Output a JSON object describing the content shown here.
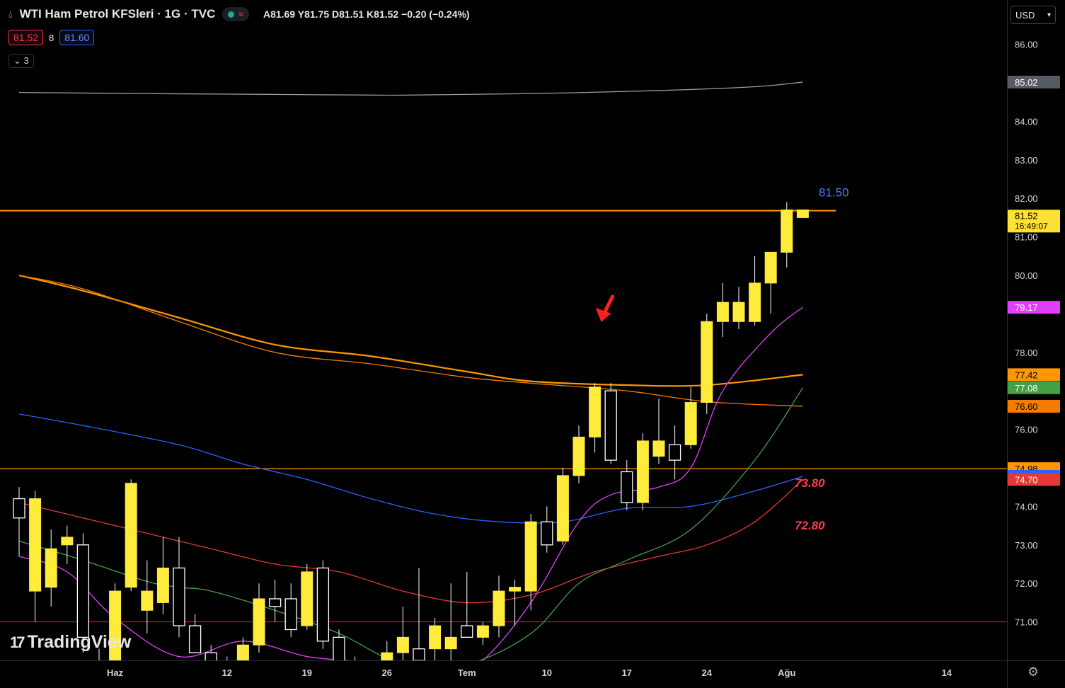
{
  "header": {
    "title": "WTI Ham Petrol KFSleri · 1G · TVC",
    "ohlc": "A81.69  Y81.75  D81.51  K81.52  −0.20 (−0.24%)",
    "sell_price": "81.52",
    "spread": "8",
    "buy_price": "81.60",
    "indicator_count": "3",
    "currency": "USD"
  },
  "logo": {
    "text": "TradingView"
  },
  "chart_data": {
    "type": "candlestick",
    "ylim": [
      70.0,
      86.6
    ],
    "y_ticks": [
      71,
      72,
      73,
      74,
      76,
      78,
      80,
      81,
      82,
      83,
      84,
      86
    ],
    "x_labels": [
      {
        "label": "Haz",
        "i": 6
      },
      {
        "label": "12",
        "i": 13
      },
      {
        "label": "19",
        "i": 18
      },
      {
        "label": "26",
        "i": 23
      },
      {
        "label": "Tem",
        "i": 28
      },
      {
        "label": "10",
        "i": 33
      },
      {
        "label": "17",
        "i": 38
      },
      {
        "label": "24",
        "i": 43
      },
      {
        "label": "Ağu",
        "i": 48
      },
      {
        "label": "14",
        "i": 58
      }
    ],
    "candles": [
      {
        "o": 74.2,
        "h": 74.5,
        "l": 72.7,
        "c": 73.7
      },
      {
        "o": 71.8,
        "h": 74.4,
        "l": 71.0,
        "c": 74.2
      },
      {
        "o": 71.9,
        "h": 73.4,
        "l": 71.4,
        "c": 72.9
      },
      {
        "o": 73.0,
        "h": 73.5,
        "l": 72.5,
        "c": 73.2
      },
      {
        "o": 73.0,
        "h": 73.3,
        "l": 70.2,
        "c": 70.6
      },
      {
        "o": 69.5,
        "h": 70.3,
        "l": 68.8,
        "c": 69.9
      },
      {
        "o": 70.0,
        "h": 72.0,
        "l": 69.8,
        "c": 71.8
      },
      {
        "o": 71.9,
        "h": 74.7,
        "l": 71.8,
        "c": 74.6
      },
      {
        "o": 71.3,
        "h": 72.6,
        "l": 70.7,
        "c": 71.8
      },
      {
        "o": 71.5,
        "h": 73.2,
        "l": 71.2,
        "c": 72.4
      },
      {
        "o": 72.4,
        "h": 73.2,
        "l": 70.6,
        "c": 70.9
      },
      {
        "o": 70.9,
        "h": 71.2,
        "l": 70.2,
        "c": 70.2
      },
      {
        "o": 70.2,
        "h": 70.4,
        "l": 69.6,
        "c": 69.9
      },
      {
        "o": 69.9,
        "h": 70.1,
        "l": 69.0,
        "c": 69.5
      },
      {
        "o": 69.6,
        "h": 70.6,
        "l": 69.2,
        "c": 70.4
      },
      {
        "o": 70.4,
        "h": 72.0,
        "l": 70.2,
        "c": 71.6
      },
      {
        "o": 71.6,
        "h": 72.1,
        "l": 71.0,
        "c": 71.4
      },
      {
        "o": 71.6,
        "h": 72.0,
        "l": 70.6,
        "c": 70.8
      },
      {
        "o": 70.9,
        "h": 72.5,
        "l": 70.8,
        "c": 72.3
      },
      {
        "o": 72.4,
        "h": 72.6,
        "l": 70.3,
        "c": 70.5
      },
      {
        "o": 70.6,
        "h": 70.8,
        "l": 69.5,
        "c": 69.7
      },
      {
        "o": 69.8,
        "h": 70.1,
        "l": 69.1,
        "c": 69.3
      },
      {
        "o": 69.4,
        "h": 69.6,
        "l": 68.9,
        "c": 69.0
      },
      {
        "o": 69.0,
        "h": 70.5,
        "l": 68.9,
        "c": 70.2
      },
      {
        "o": 70.2,
        "h": 71.4,
        "l": 69.9,
        "c": 70.6
      },
      {
        "o": 70.3,
        "h": 72.4,
        "l": 69.9,
        "c": 70.0
      },
      {
        "o": 70.3,
        "h": 71.1,
        "l": 69.9,
        "c": 70.9
      },
      {
        "o": 70.3,
        "h": 72.0,
        "l": 69.9,
        "c": 70.6
      },
      {
        "o": 70.9,
        "h": 72.3,
        "l": 70.8,
        "c": 70.6
      },
      {
        "o": 70.6,
        "h": 71.0,
        "l": 70.4,
        "c": 70.9
      },
      {
        "o": 70.9,
        "h": 72.2,
        "l": 70.6,
        "c": 71.8
      },
      {
        "o": 71.8,
        "h": 72.1,
        "l": 70.9,
        "c": 71.9
      },
      {
        "o": 71.8,
        "h": 73.8,
        "l": 71.3,
        "c": 73.6
      },
      {
        "o": 73.6,
        "h": 74.0,
        "l": 72.8,
        "c": 73.0
      },
      {
        "o": 73.1,
        "h": 75.0,
        "l": 73.0,
        "c": 74.8
      },
      {
        "o": 74.8,
        "h": 76.1,
        "l": 74.6,
        "c": 75.8
      },
      {
        "o": 75.8,
        "h": 77.2,
        "l": 75.4,
        "c": 77.1
      },
      {
        "o": 77.0,
        "h": 77.2,
        "l": 75.1,
        "c": 75.2
      },
      {
        "o": 74.9,
        "h": 75.2,
        "l": 73.9,
        "c": 74.1
      },
      {
        "o": 74.1,
        "h": 75.9,
        "l": 73.9,
        "c": 75.7
      },
      {
        "o": 75.3,
        "h": 76.8,
        "l": 75.1,
        "c": 75.7
      },
      {
        "o": 75.6,
        "h": 76.1,
        "l": 74.7,
        "c": 75.2
      },
      {
        "o": 75.6,
        "h": 77.1,
        "l": 75.5,
        "c": 76.7
      },
      {
        "o": 76.7,
        "h": 79.0,
        "l": 76.4,
        "c": 78.8
      },
      {
        "o": 78.8,
        "h": 79.8,
        "l": 78.4,
        "c": 79.3
      },
      {
        "o": 78.8,
        "h": 79.7,
        "l": 78.6,
        "c": 79.3
      },
      {
        "o": 78.8,
        "h": 80.5,
        "l": 78.7,
        "c": 79.8
      },
      {
        "o": 79.8,
        "h": 80.6,
        "l": 79.0,
        "c": 80.6
      },
      {
        "o": 80.6,
        "h": 81.9,
        "l": 80.2,
        "c": 81.7
      },
      {
        "o": 81.5,
        "h": 81.7,
        "l": 81.5,
        "c": 81.7
      }
    ],
    "moving_averages": [
      {
        "color": "#9e9e9e",
        "values": [
          [
            0,
            84.75
          ],
          [
            8,
            84.72
          ],
          [
            16,
            84.7
          ],
          [
            24,
            84.68
          ],
          [
            32,
            84.72
          ],
          [
            40,
            84.8
          ],
          [
            46,
            84.9
          ],
          [
            49,
            85.02
          ]
        ]
      },
      {
        "color": "#ff9800",
        "values": [
          [
            0,
            80.0
          ],
          [
            4,
            79.6
          ],
          [
            10,
            78.9
          ],
          [
            16,
            78.2
          ],
          [
            22,
            77.9
          ],
          [
            28,
            77.5
          ],
          [
            32,
            77.25
          ],
          [
            38,
            77.15
          ],
          [
            43,
            77.15
          ],
          [
            49,
            77.42
          ]
        ]
      },
      {
        "color": "#f57c00",
        "values": [
          [
            0,
            80.0
          ],
          [
            4,
            79.65
          ],
          [
            10,
            78.8
          ],
          [
            16,
            78.0
          ],
          [
            22,
            77.7
          ],
          [
            28,
            77.35
          ],
          [
            32,
            77.2
          ],
          [
            38,
            77.0
          ],
          [
            43,
            76.72
          ],
          [
            49,
            76.6
          ]
        ]
      },
      {
        "color": "#2962ff",
        "values": [
          [
            0,
            76.4
          ],
          [
            4,
            76.1
          ],
          [
            10,
            75.6
          ],
          [
            14,
            75.1
          ],
          [
            18,
            74.7
          ],
          [
            22,
            74.2
          ],
          [
            26,
            73.8
          ],
          [
            30,
            73.6
          ],
          [
            34,
            73.6
          ],
          [
            38,
            73.95
          ],
          [
            42,
            74.0
          ],
          [
            46,
            74.4
          ],
          [
            49,
            74.78
          ]
        ]
      },
      {
        "color": "#e53935",
        "values": [
          [
            0,
            74.1
          ],
          [
            4,
            73.7
          ],
          [
            8,
            73.3
          ],
          [
            12,
            72.9
          ],
          [
            16,
            72.5
          ],
          [
            20,
            72.3
          ],
          [
            24,
            71.8
          ],
          [
            28,
            71.5
          ],
          [
            32,
            71.7
          ],
          [
            36,
            72.3
          ],
          [
            40,
            72.7
          ],
          [
            43,
            73.0
          ],
          [
            46,
            73.6
          ],
          [
            49,
            74.7
          ]
        ]
      },
      {
        "color": "#43a047",
        "values": [
          [
            0,
            73.1
          ],
          [
            4,
            72.6
          ],
          [
            8,
            72.05
          ],
          [
            10,
            71.9
          ],
          [
            12,
            71.8
          ],
          [
            16,
            71.3
          ],
          [
            20,
            70.7
          ],
          [
            24,
            69.9
          ],
          [
            28,
            69.9
          ],
          [
            32,
            70.7
          ],
          [
            35,
            72.0
          ],
          [
            38,
            72.6
          ],
          [
            42,
            73.4
          ],
          [
            46,
            75.2
          ],
          [
            49,
            77.08
          ]
        ]
      },
      {
        "color": "#e040fb",
        "values": [
          [
            0,
            72.7
          ],
          [
            3,
            72.3
          ],
          [
            6,
            71.1
          ],
          [
            10,
            70.1
          ],
          [
            14,
            70.5
          ],
          [
            18,
            70.1
          ],
          [
            22,
            69.9
          ],
          [
            26,
            69.3
          ],
          [
            29,
            70.0
          ],
          [
            32,
            71.5
          ],
          [
            35,
            73.6
          ],
          [
            37,
            74.3
          ],
          [
            40,
            74.5
          ],
          [
            42,
            75.0
          ],
          [
            44,
            77.0
          ],
          [
            47,
            78.5
          ],
          [
            49,
            79.17
          ]
        ]
      }
    ],
    "horizontal_lines": [
      {
        "y": 81.68,
        "color": "#ff9800",
        "width": 2,
        "x_end_frac": 0.83
      },
      {
        "y": 74.98,
        "color": "#ff9800",
        "width": 1.2
      },
      {
        "y": 71.0,
        "color": "#d32f2f",
        "width": 1
      }
    ],
    "annotations": [
      {
        "text": "81.50",
        "color": "#4f79ff",
        "x_index": 50,
        "y": 82.05,
        "italic": false
      },
      {
        "text": "73.80",
        "color": "#ff3b4f",
        "x_index": 48.5,
        "y": 74.5,
        "italic": true
      },
      {
        "text": "72.80",
        "color": "#ff3b4f",
        "x_index": 48.5,
        "y": 73.4,
        "italic": true
      }
    ],
    "price_labels": [
      {
        "text": "85.02",
        "y": 85.02,
        "bg": "#555a63",
        "fg": "#ffffff"
      },
      {
        "text": "81.52",
        "sub": "16:49:07",
        "y": 81.52,
        "bg": "#ffe135",
        "fg": "#000000"
      },
      {
        "text": "79.17",
        "y": 79.17,
        "bg": "#e040fb",
        "fg": "#ffffff"
      },
      {
        "text": "77.42",
        "y": 77.42,
        "bg": "#ff9800",
        "fg": "#000000"
      },
      {
        "text": "77.08",
        "y": 77.08,
        "bg": "#43a047",
        "fg": "#ffffff"
      },
      {
        "text": "76.60",
        "y": 76.6,
        "bg": "#f57c00",
        "fg": "#000000"
      },
      {
        "text": "74.98",
        "y": 74.98,
        "bg": "#ff9800",
        "fg": "#000000"
      },
      {
        "text": "74.78",
        "y": 74.78,
        "bg": "#2962ff",
        "fg": "#ffffff"
      },
      {
        "text": "74.70",
        "y": 74.7,
        "bg": "#e53935",
        "fg": "#ffffff"
      }
    ],
    "colors": {
      "up_body": "#ffeb3b",
      "down_body": "#ffffff",
      "wick": "#ffffff",
      "arrow": "#ff1f1f"
    }
  }
}
